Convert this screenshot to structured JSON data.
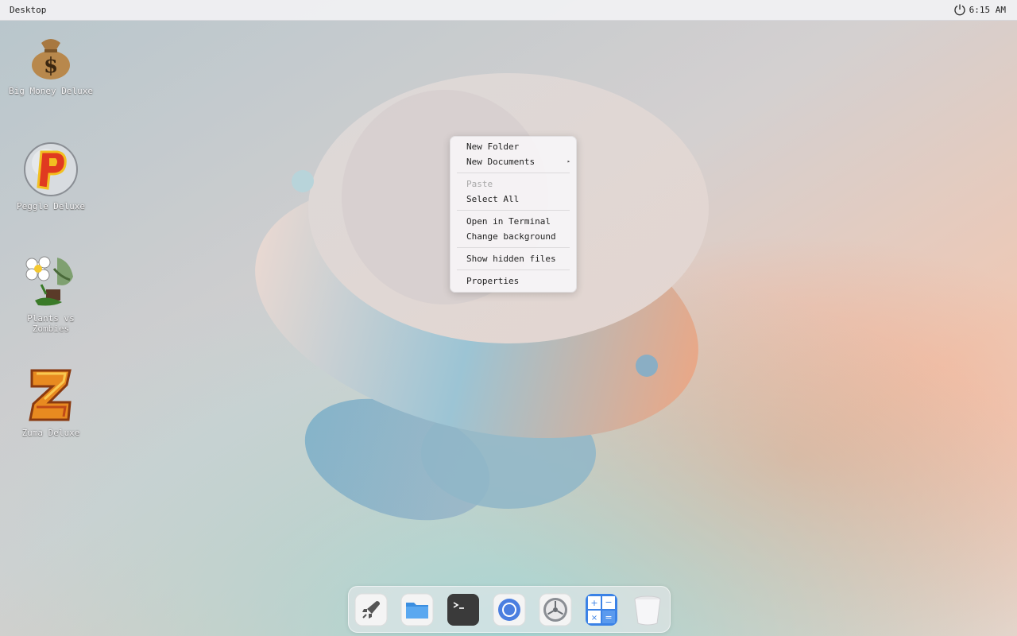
{
  "topbar": {
    "title": "Desktop",
    "clock": "6:15 AM",
    "power_icon": "power-icon"
  },
  "desktop_icons": [
    {
      "label": "Big Money Deluxe",
      "icon": "money-bag-icon"
    },
    {
      "label": "Peggle Deluxe",
      "icon": "peggle-icon"
    },
    {
      "label": "Plants vs Zombies",
      "icon": "plants-vs-zombies-icon"
    },
    {
      "label": "Zuma Deluxe",
      "icon": "zuma-icon"
    }
  ],
  "context_menu": {
    "items": [
      {
        "label": "New Folder",
        "disabled": false
      },
      {
        "label": "New Documents",
        "disabled": false,
        "submenu": true
      },
      {
        "label": "Paste",
        "disabled": true
      },
      {
        "label": "Select All",
        "disabled": false
      },
      {
        "label": "Open in Terminal",
        "disabled": false
      },
      {
        "label": "Change background",
        "disabled": false
      },
      {
        "label": "Show hidden files",
        "disabled": false
      },
      {
        "label": "Properties",
        "disabled": false
      }
    ],
    "submenu_arrow": "▸"
  },
  "dock": {
    "items": [
      {
        "icon": "launcher-rocket-icon"
      },
      {
        "icon": "files-folder-icon"
      },
      {
        "icon": "terminal-icon"
      },
      {
        "icon": "browser-icon"
      },
      {
        "icon": "settings-gear-icon"
      },
      {
        "icon": "calculator-icon"
      },
      {
        "icon": "trash-icon"
      }
    ]
  },
  "colors": {
    "menu_bg": "#f6f4f6",
    "disabled_text": "#a8a8a8",
    "terminal_bg": "#3a3a3a",
    "folder_blue": "#4a9be8",
    "calculator_blue": "#3b82e6"
  }
}
